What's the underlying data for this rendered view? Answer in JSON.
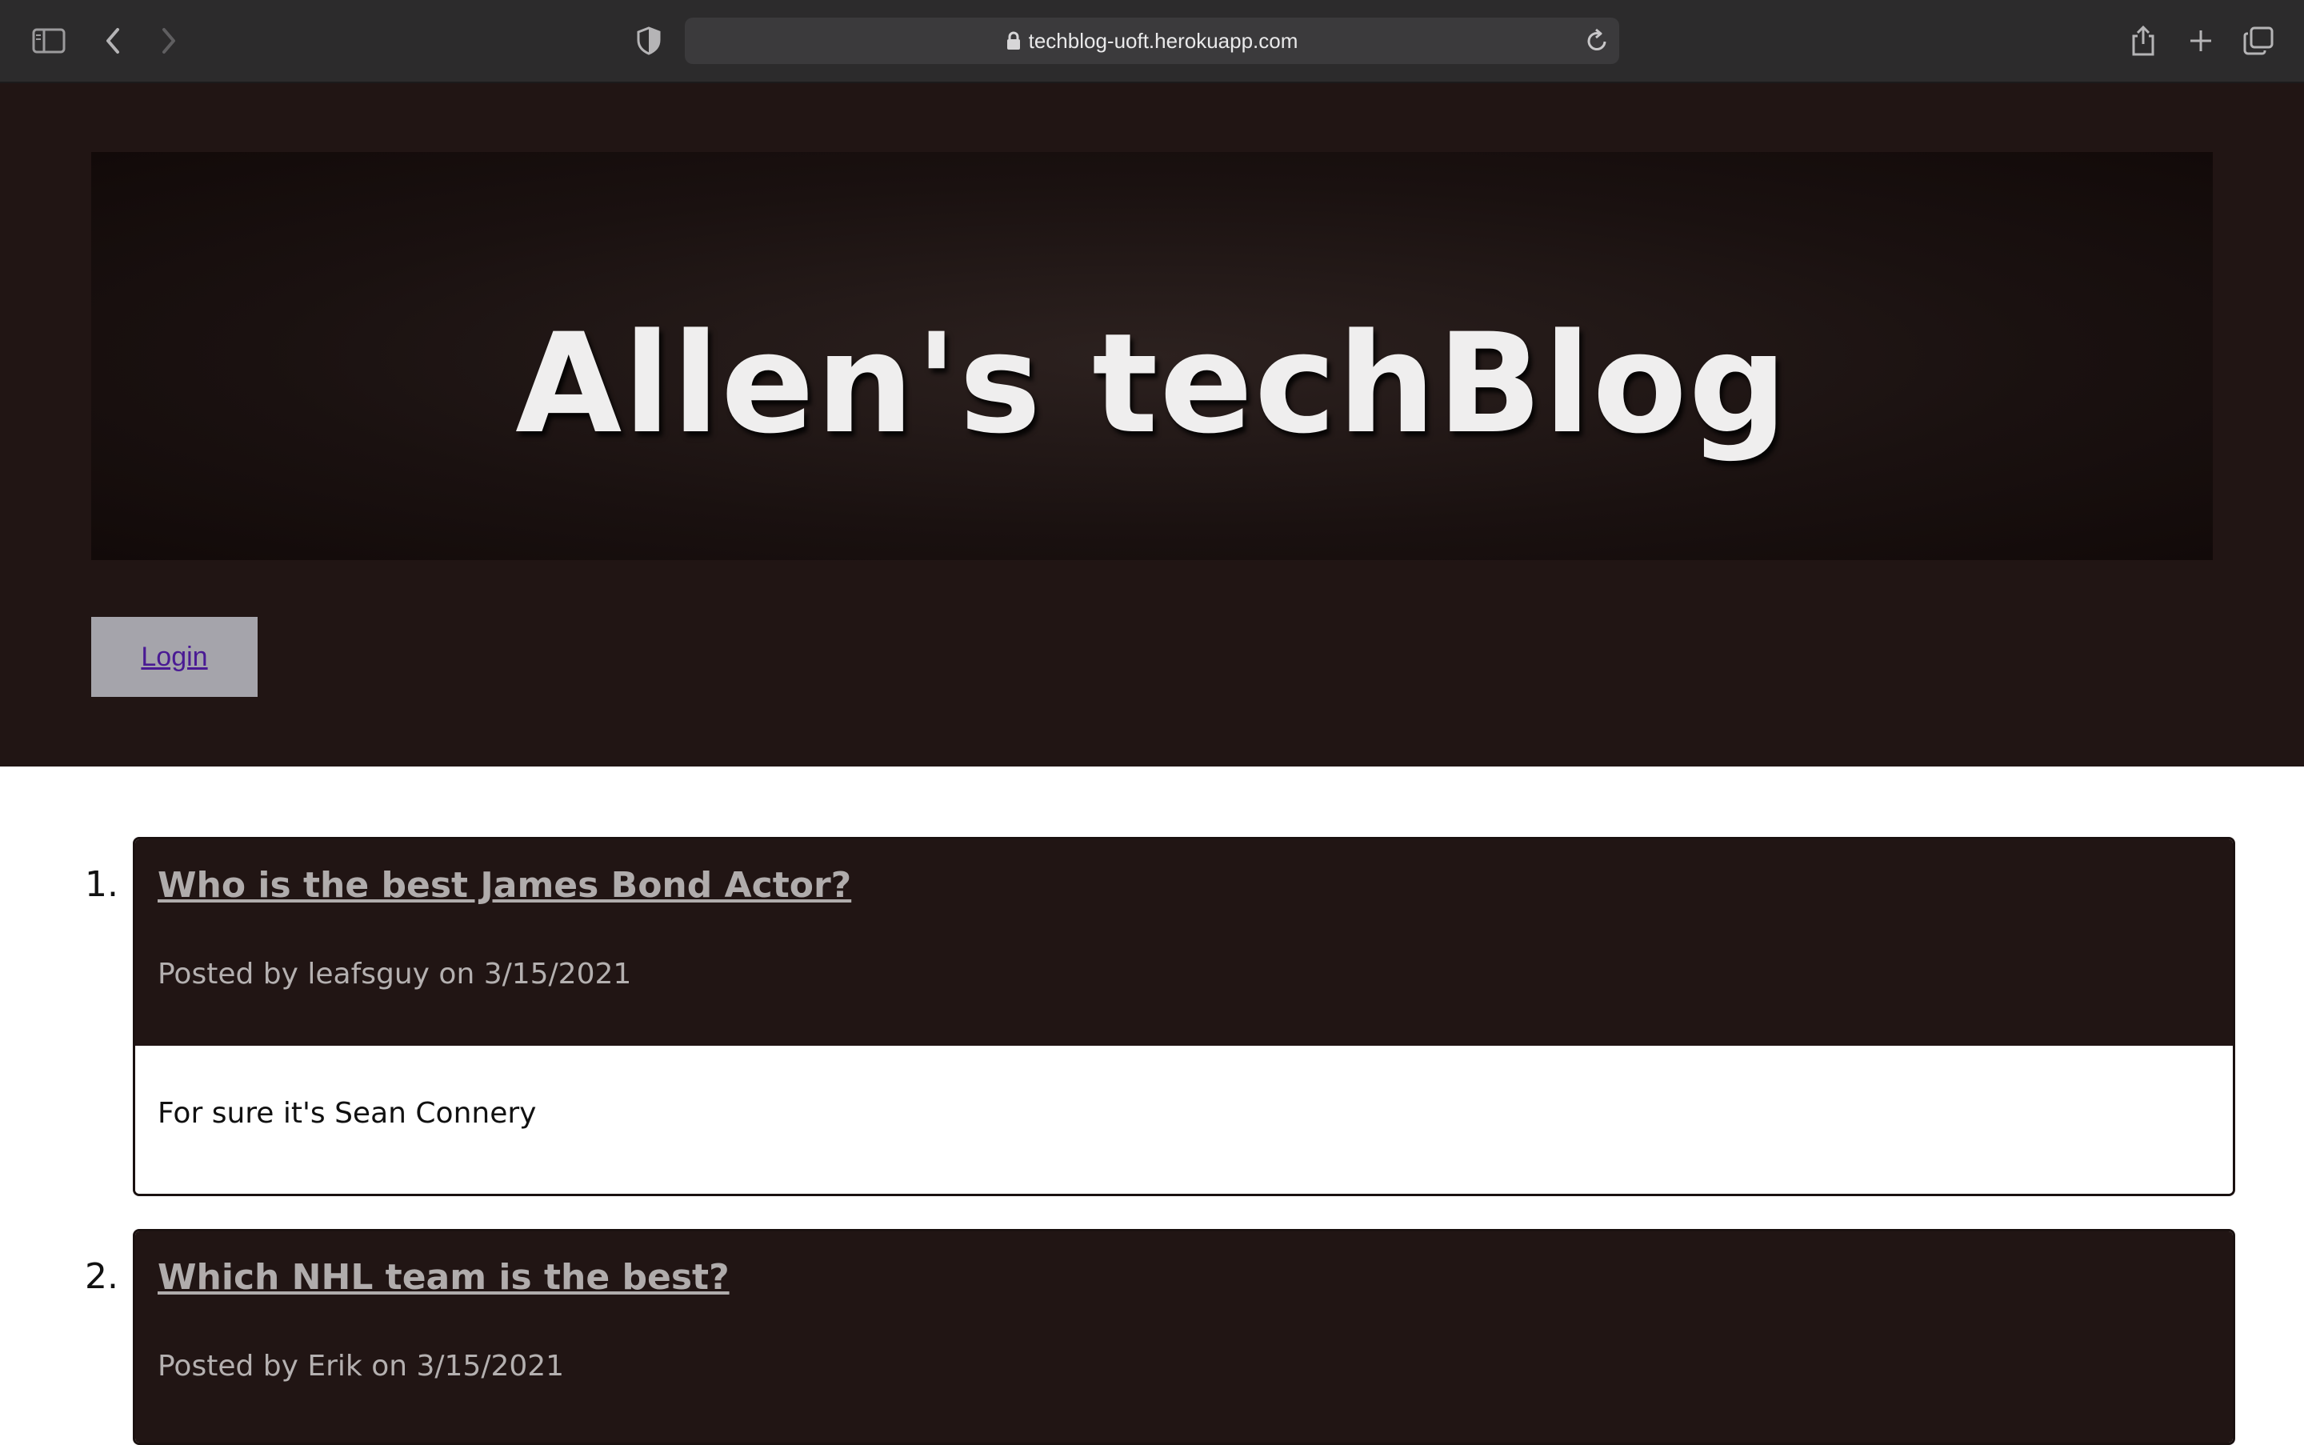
{
  "browser": {
    "url": "techblog-uoft.herokuapp.com",
    "icons": {
      "sidebar": "sidebar-icon",
      "back": "chevron-left-icon",
      "forward": "chevron-right-icon",
      "privacy": "shield-icon",
      "lock": "lock-icon",
      "reload": "reload-icon",
      "share": "share-icon",
      "new_tab": "plus-icon",
      "tab_overview": "tabs-icon"
    }
  },
  "header": {
    "title": "Allen's techBlog",
    "login_label": "Login"
  },
  "posts": [
    {
      "number": "1.",
      "title": "Who is the best James Bond Actor?",
      "meta": "Posted by leafsguy on 3/15/2021",
      "content": "For sure it's Sean Connery"
    },
    {
      "number": "2.",
      "title": "Which NHL team is the best?",
      "meta": "Posted by Erik on 3/15/2021",
      "content": ""
    }
  ],
  "colors": {
    "header_bg": "#211514",
    "login_bg": "#a5a4ab",
    "login_text": "#4a1a94",
    "post_title": "#b0acac"
  }
}
